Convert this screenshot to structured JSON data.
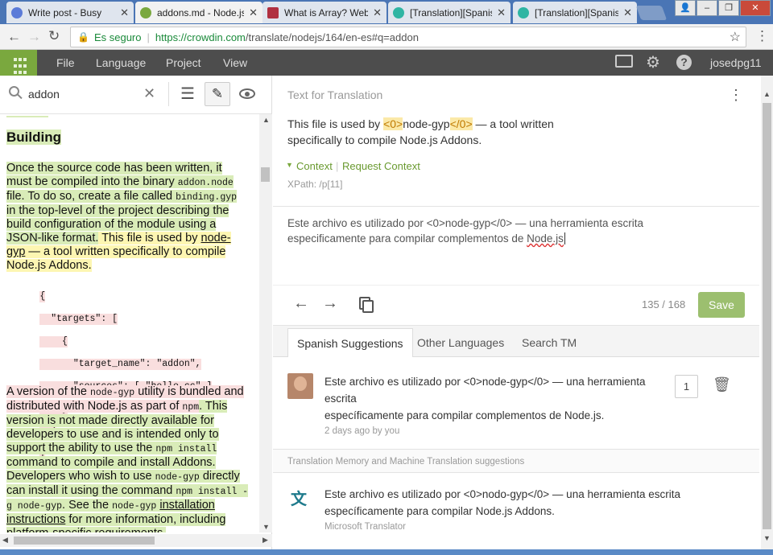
{
  "browser": {
    "tabs": [
      {
        "label": "Write post - Busy",
        "color": "#5b7bd8"
      },
      {
        "label": "addons.md - Node.js",
        "color": "#7aa83e"
      },
      {
        "label": "What is Array? Web",
        "color": "#b03040"
      },
      {
        "label": "[Translation][Spanish",
        "color": "#2fb5a3"
      },
      {
        "label": "[Translation][Spanish",
        "color": "#2fb5a3"
      }
    ],
    "secure_label": "Es seguro",
    "url_host": "https://crowdin.com",
    "url_path": "/translate/nodejs/164/en-es#q=addon"
  },
  "app": {
    "menu": [
      "File",
      "Language",
      "Project",
      "View"
    ],
    "username": "josedpg11"
  },
  "search": {
    "value": "addon"
  },
  "doc": {
    "heading": "Building",
    "p1_a": "Once the source code has been written, it must be compiled into the binary ",
    "p1_code1": "addon.node",
    "p1_b": " file.",
    "p1_c": " To do so, create a file called ",
    "p1_code2": "binding.gyp",
    "p1_d": " in the top-level of the project describing the build configuration of the module using a JSON-like format.",
    "p1_e": " This file is used by ",
    "p1_link": "node-gyp",
    "p1_f": " — a tool written specifically to compile Node.js Addons.",
    "code_lines": [
      "{",
      "  \"targets\": [",
      "    {",
      "      \"target_name\": \"addon\",",
      "      \"sources\": [ \"hello.cc\" ]",
      "    }",
      "  ]",
      "}"
    ],
    "p2_a": "A version of the ",
    "p2_code1": "node-gyp",
    "p2_b": " utility is bundled and distributed with Node.js as part of ",
    "p2_code2": "npm",
    "p2_c": ". This version is not made directly available for developers to use and is intended only to support the ability to use the ",
    "p2_code3": "npm install",
    "p2_d": " command to compile and install Addons. Developers who wish to use ",
    "p2_code4": "node-gyp",
    "p2_e": " directly can install it using the command ",
    "p2_code5": "npm install -g node-gyp",
    "p2_f": ". See the ",
    "p2_code6": "node-gyp",
    "p2_link": "installation instructions",
    "p2_g": " for more information, including platform-specific requirements."
  },
  "editor": {
    "section_title": "Text for Translation",
    "source_a": "This file is used by ",
    "source_tag_open": "<0>",
    "source_mid": "node-gyp",
    "source_tag_close": "</0>",
    "source_b": " — a tool written",
    "source_line2": "specifically to compile Node.js Addons.",
    "context_label": "Context",
    "request_context": "Request Context",
    "xpath": "XPath: /p[11]",
    "translation_line1": "Este archivo es utilizado por <0>node-gyp</0> — una herramienta escrita",
    "translation_line2_a": "especificamente para compilar complementos de ",
    "translation_line2_b": "Node.js",
    "counter": "135 / 168",
    "save_label": "Save"
  },
  "suggestions": {
    "tabs": [
      "Spanish Suggestions",
      "Other Languages",
      "Search TM"
    ],
    "item1_line1": "Este archivo es utilizado por <0>node-gyp</0> — una herramienta",
    "item1_line2": "escrita",
    "item1_line3": "específicamente para compilar complementos de Node.js.",
    "item1_meta": "2 days ago by you",
    "item1_votes": "1",
    "tm_header": "Translation Memory and Machine Translation suggestions",
    "item2_line1": "Este archivo es utilizado por <0>nodo-gyp</0> — una herramienta escrita",
    "item2_line2": "específicamente para compilar Node.js Addons.",
    "item2_meta": "Microsoft Translator"
  },
  "colors": {
    "accent_green": "#7aa83e",
    "header_dark": "#4d4d4d",
    "save_green": "#9cbf6f",
    "tag_orange": "#e0a020"
  }
}
